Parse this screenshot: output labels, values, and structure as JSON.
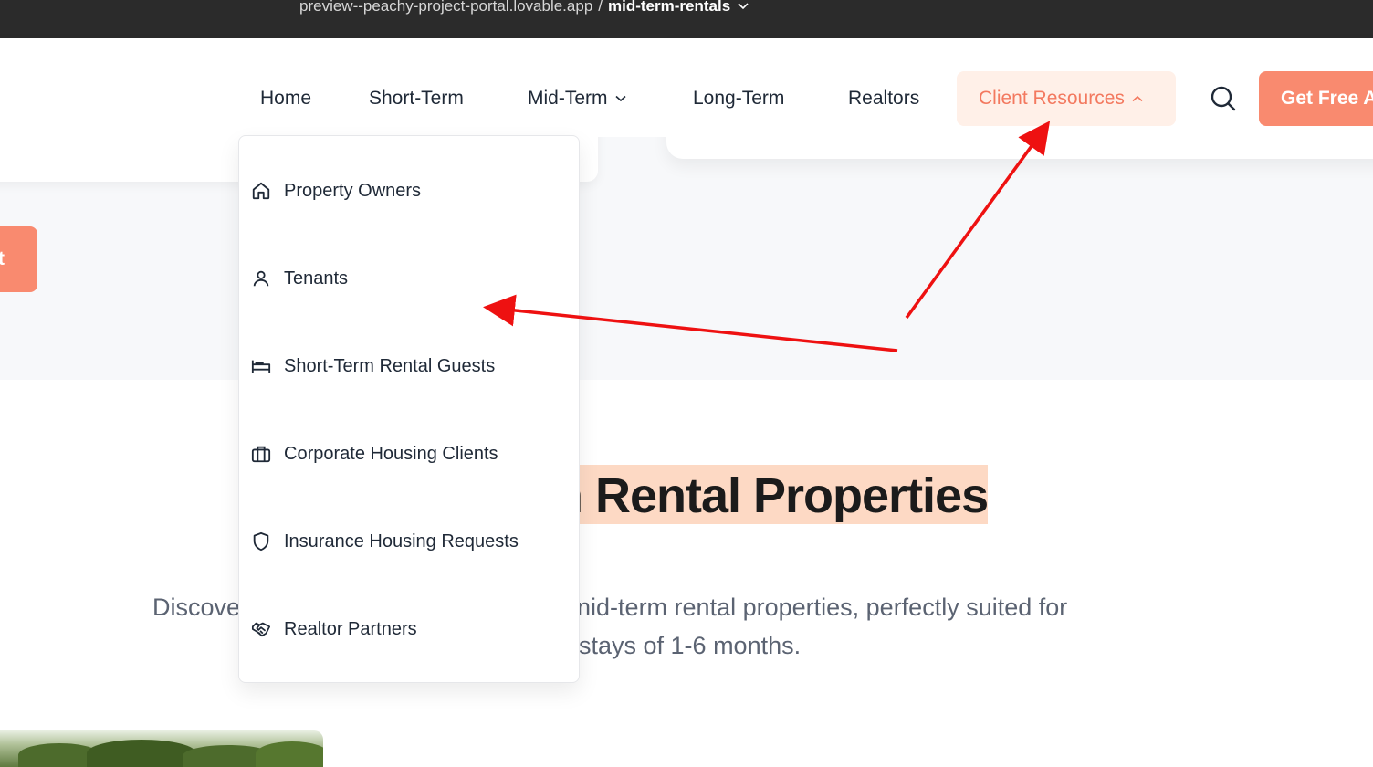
{
  "browser": {
    "url": "preview--peachy-project-portal.lovable.app",
    "separator": "/",
    "page": "mid-term-rentals"
  },
  "nav": {
    "items": [
      {
        "label": "Home"
      },
      {
        "label": "Short-Term"
      },
      {
        "label": "Mid-Term"
      },
      {
        "label": "Long-Term"
      },
      {
        "label": "Realtors"
      },
      {
        "label": "Client Resources"
      }
    ],
    "cta_label": "Get Free A",
    "left_cta_label": "t"
  },
  "dropdown": {
    "items": [
      {
        "label": "Property Owners",
        "icon": "home-icon"
      },
      {
        "label": "Tenants",
        "icon": "user-icon"
      },
      {
        "label": "Short-Term Rental Guests",
        "icon": "bed-icon"
      },
      {
        "label": "Corporate Housing Clients",
        "icon": "briefcase-icon"
      },
      {
        "label": "Insurance Housing Requests",
        "icon": "shield-icon"
      },
      {
        "label": "Realtor Partners",
        "icon": "handshake-icon"
      }
    ]
  },
  "hero": {
    "heading": "n Rental Properties",
    "paragraph_line1_left": "Discove",
    "paragraph_line1_right": "nid-term rental properties, perfectly suited for",
    "paragraph_line2": "stays of 1-6 months."
  },
  "colors": {
    "accent": "#f98a6f",
    "accent_text": "#f3795f",
    "active_bg": "#fff0e8",
    "highlight": "#fdd9c4",
    "annotation_arrow": "#ee1111"
  }
}
